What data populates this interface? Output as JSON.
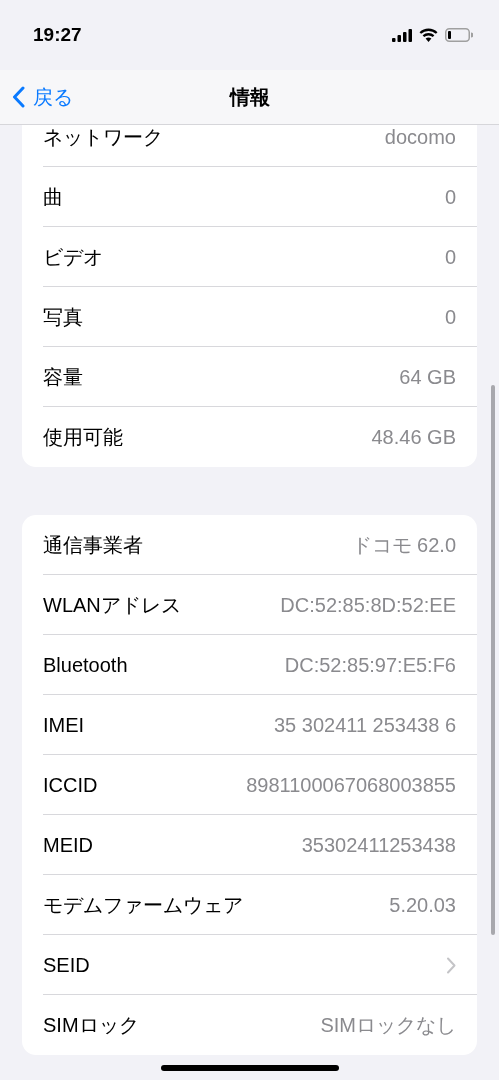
{
  "status_bar": {
    "time": "19:27"
  },
  "nav": {
    "back": "戻る",
    "title": "情報"
  },
  "sections": [
    {
      "rows": [
        {
          "kind": "value",
          "label": "ネットワーク",
          "value": "docomo"
        },
        {
          "kind": "value",
          "label": "曲",
          "value": "0"
        },
        {
          "kind": "value",
          "label": "ビデオ",
          "value": "0"
        },
        {
          "kind": "value",
          "label": "写真",
          "value": "0"
        },
        {
          "kind": "value",
          "label": "容量",
          "value": "64 GB"
        },
        {
          "kind": "value",
          "label": "使用可能",
          "value": "48.46 GB"
        }
      ]
    },
    {
      "rows": [
        {
          "kind": "value",
          "label": "通信事業者",
          "value": "ドコモ 62.0"
        },
        {
          "kind": "value",
          "label": "WLANアドレス",
          "value": "DC:52:85:8D:52:EE"
        },
        {
          "kind": "value",
          "label": "Bluetooth",
          "value": "DC:52:85:97:E5:F6"
        },
        {
          "kind": "value",
          "label": "IMEI",
          "value": "35 302411 253438 6"
        },
        {
          "kind": "value",
          "label": "ICCID",
          "value": "8981100067068003855"
        },
        {
          "kind": "value",
          "label": "MEID",
          "value": "35302411253438"
        },
        {
          "kind": "value",
          "label": "モデムファームウェア",
          "value": "5.20.03"
        },
        {
          "kind": "chevron",
          "label": "SEID"
        },
        {
          "kind": "value",
          "label": "SIMロック",
          "value": "SIMロックなし"
        }
      ]
    }
  ]
}
